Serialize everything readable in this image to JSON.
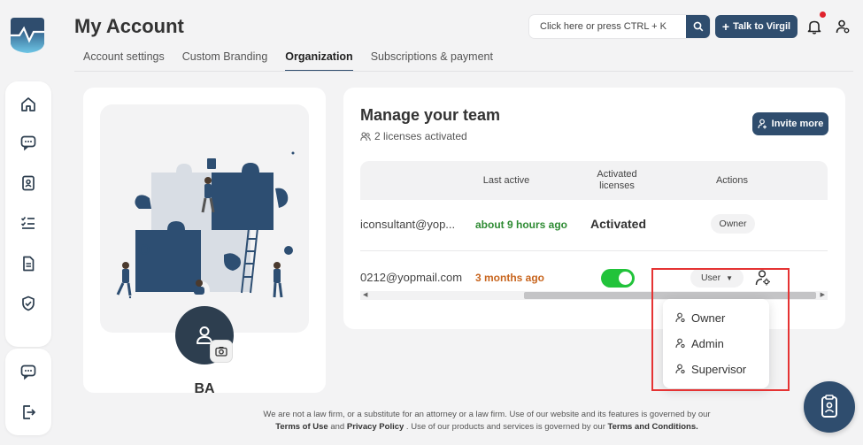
{
  "colors": {
    "brand": "#2f4d6e",
    "toggle_on": "#21c33a",
    "highlight": "#e53333",
    "last_active_recent": "#2e8b33",
    "last_active_old": "#c8651e"
  },
  "header": {
    "title": "My Account",
    "search_placeholder": "Click here or press CTRL + K",
    "talk_button": "Talk to Virgil",
    "notification_badge": true
  },
  "tabs": [
    {
      "label": "Account settings",
      "active": false
    },
    {
      "label": "Custom Branding",
      "active": false
    },
    {
      "label": "Organization",
      "active": true
    },
    {
      "label": "Subscriptions & payment",
      "active": false
    }
  ],
  "sidebar": {
    "items": [
      {
        "icon": "home-icon"
      },
      {
        "icon": "chat-icon"
      },
      {
        "icon": "contact-card-icon"
      },
      {
        "icon": "checklist-icon"
      },
      {
        "icon": "document-icon"
      },
      {
        "icon": "shield-check-icon"
      },
      {
        "icon": "feedback-chat-icon"
      },
      {
        "icon": "logout-icon"
      }
    ]
  },
  "profile": {
    "initials": "BA"
  },
  "team": {
    "title": "Manage your team",
    "licenses": "2 licenses activated",
    "invite_button": "Invite more",
    "columns": [
      "Last active",
      "Activated licenses",
      "Actions"
    ],
    "rows": [
      {
        "email": "iconsultant@yop...",
        "last_active": "about 9 hours ago",
        "license": "Activated",
        "role": "Owner"
      },
      {
        "email": "0212@yopmail.com",
        "last_active": "3 months ago",
        "license_toggle": true,
        "role": "User"
      }
    ]
  },
  "role_dropdown": {
    "options": [
      "Owner",
      "Admin",
      "Supervisor"
    ]
  },
  "footer": {
    "line1": "We are not a law firm, or a substitute for an attorney or a law firm. Use of our website and its features is governed by our",
    "terms": "Terms of Use",
    "and": " and ",
    "privacy": "Privacy Policy",
    "line2_mid": " . Use of our products and services is governed by our ",
    "terms_conditions": "Terms and Conditions."
  }
}
